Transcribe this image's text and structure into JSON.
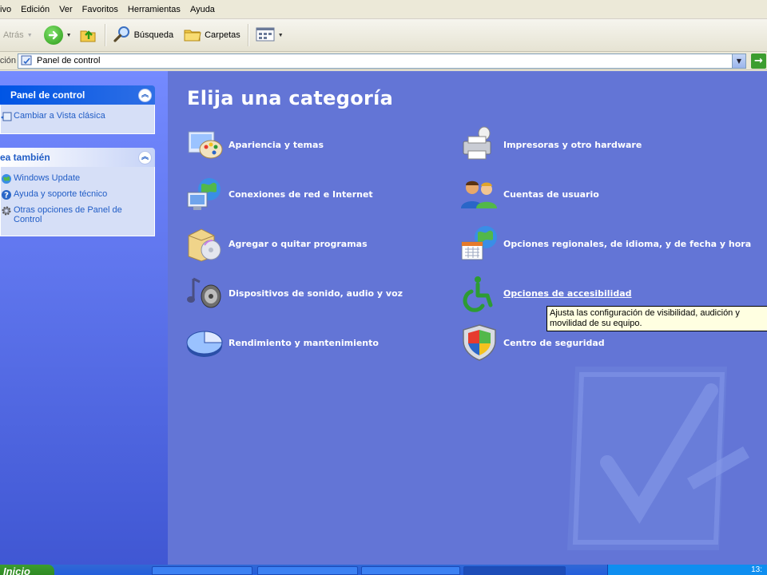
{
  "menu": [
    "ivo",
    "Edición",
    "Ver",
    "Favoritos",
    "Herramientas",
    "Ayuda"
  ],
  "toolbar": {
    "back_label": "Atrás",
    "search_label": "Búsqueda",
    "folders_label": "Carpetas"
  },
  "address": {
    "label": "ción",
    "value": "Panel de control"
  },
  "sidebar": {
    "panel1_title": "Panel de control",
    "panel1_link": "Cambiar a Vista clásica",
    "panel2_title": "ea también",
    "links": [
      "Windows Update",
      "Ayuda y soporte técnico",
      "Otras opciones de Panel de Control"
    ]
  },
  "main": {
    "title": "Elija una categoría",
    "categories": [
      "Apariencia y temas",
      "Conexiones de red e Internet",
      "Agregar o quitar programas",
      "Dispositivos de sonido, audio y voz",
      "Rendimiento y mantenimiento",
      "Impresoras y otro hardware",
      "Cuentas de usuario",
      "Opciones regionales, de idioma, y de fecha y hora",
      "Opciones de accesibilidad",
      "Centro de seguridad"
    ],
    "tooltip": "Ajusta las configuración de visibilidad, audición y movilidad de su equipo."
  },
  "taskbar": {
    "start_label": "Inicio",
    "clock": "13:"
  },
  "colors": {
    "content_bg": "#6375d6",
    "sidebar_bg": "#748aff",
    "panel_head": "#0055e5",
    "link": "#215dc6",
    "tooltip_bg": "#ffffe1"
  }
}
